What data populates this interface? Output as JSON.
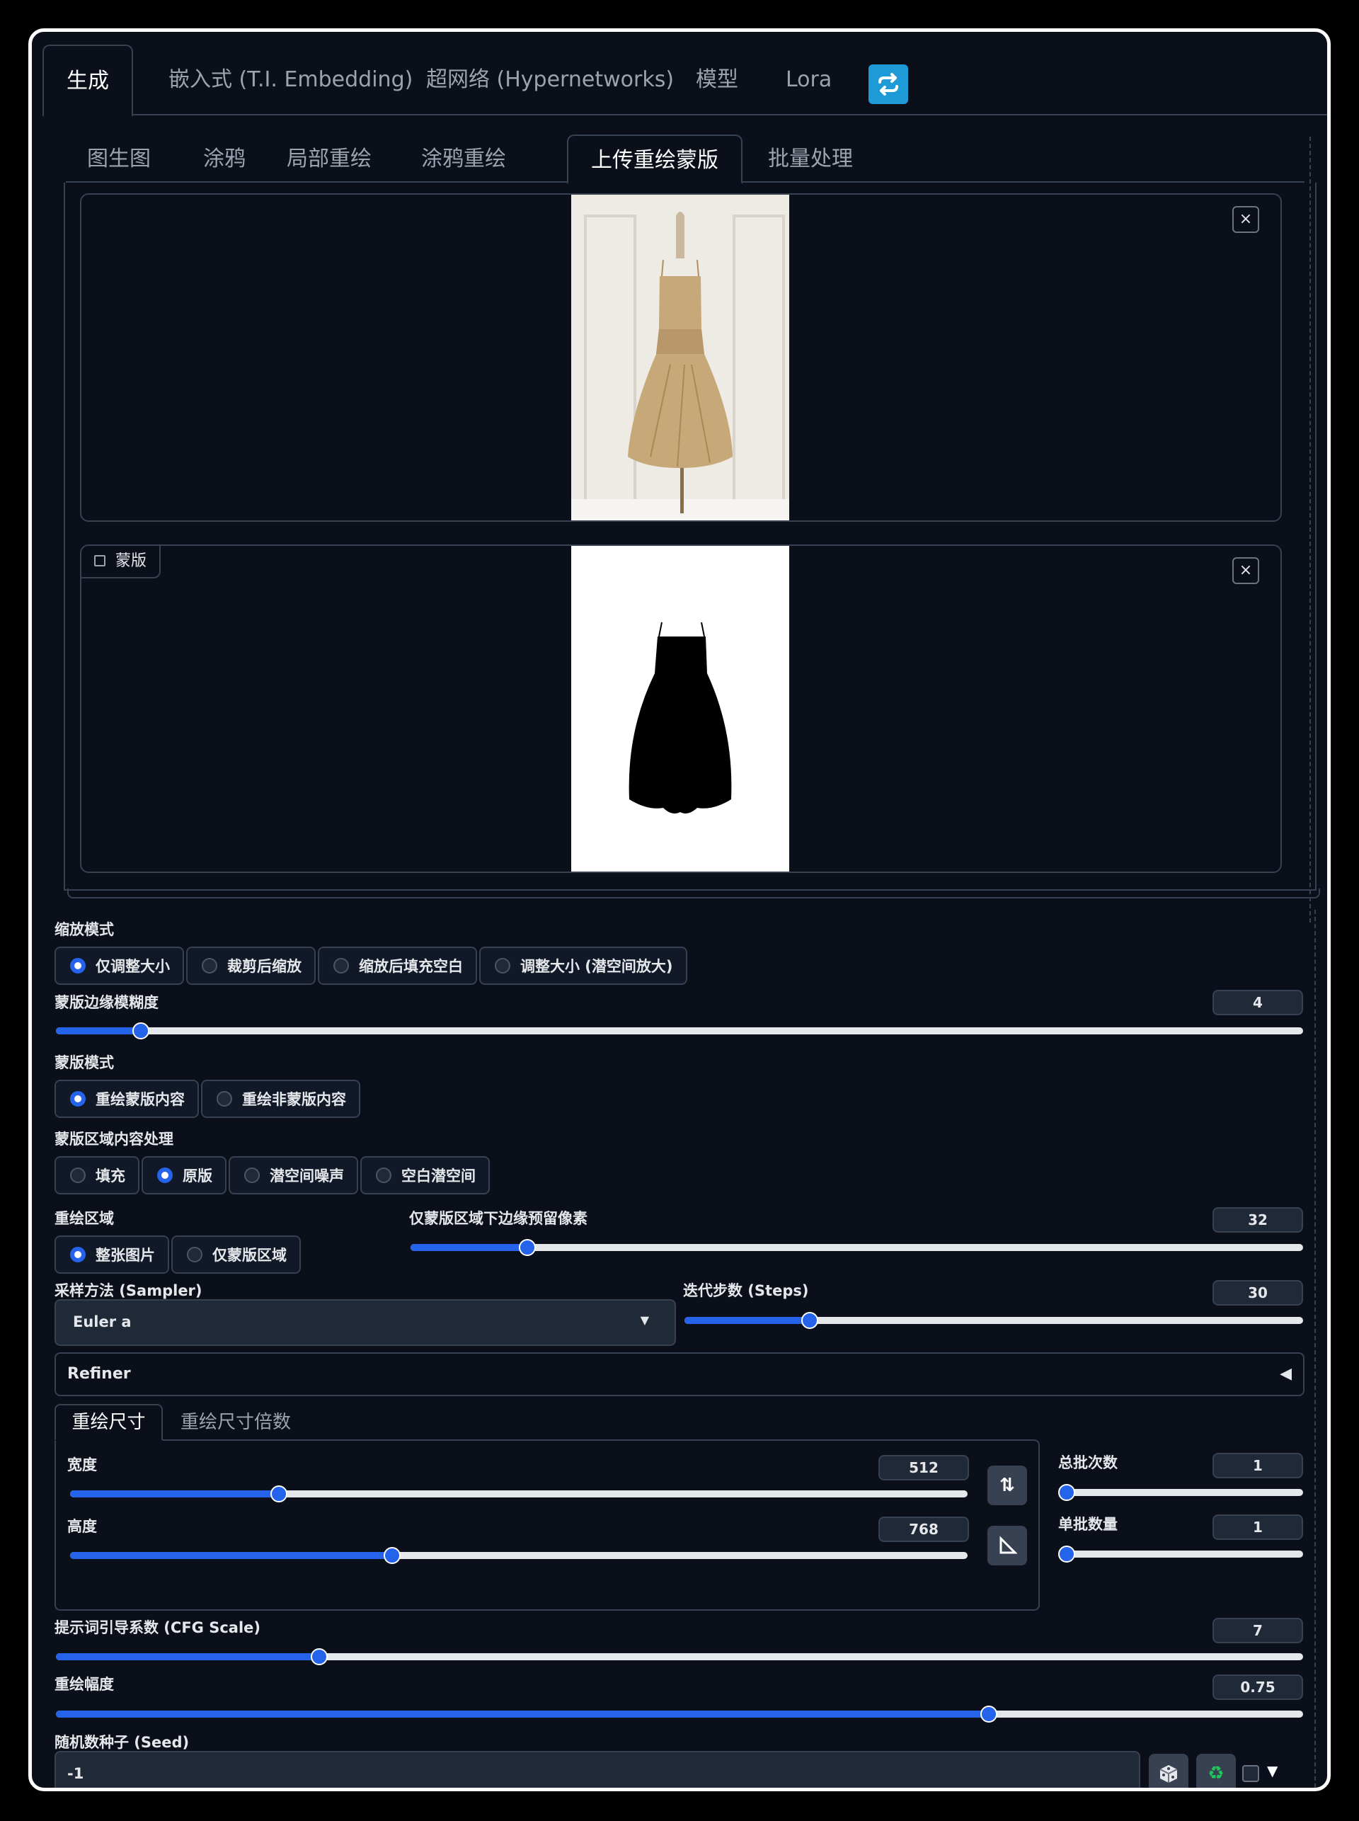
{
  "main_tabs": [
    "生成",
    "嵌入式 (T.I. Embedding)",
    "超网络 (Hypernetworks)",
    "模型",
    "Lora"
  ],
  "sub_tabs": [
    "图生图",
    "涂鸦",
    "局部重绘",
    "涂鸦重绘",
    "上传重绘蒙版",
    "批量处理"
  ],
  "images": {
    "close_label": "×",
    "mask_label": "蒙版"
  },
  "resize_mode": {
    "label": "缩放模式",
    "options": [
      "仅调整大小",
      "裁剪后缩放",
      "缩放后填充空白",
      "调整大小 (潜空间放大)"
    ],
    "selected": 0
  },
  "mask_blur": {
    "label": "蒙版边缘模糊度",
    "value": "4",
    "fraction": 0.068
  },
  "mask_mode": {
    "label": "蒙版模式",
    "options": [
      "重绘蒙版内容",
      "重绘非蒙版内容"
    ],
    "selected": 0
  },
  "masked_content": {
    "label": "蒙版区域内容处理",
    "options": [
      "填充",
      "原版",
      "潜空间噪声",
      "空白潜空间"
    ],
    "selected": 1
  },
  "inpaint_area": {
    "label": "重绘区域",
    "options": [
      "整张图片",
      "仅蒙版区域"
    ],
    "selected": 0
  },
  "only_masked_padding": {
    "label": "仅蒙版区域下边缘预留像素",
    "value": "32",
    "fraction": 0.131
  },
  "sampler": {
    "label": "采样方法 (Sampler)",
    "value": "Euler a"
  },
  "steps": {
    "label": "迭代步数 (Steps)",
    "value": "30",
    "fraction": 0.203
  },
  "refiner": {
    "label": "Refiner"
  },
  "size_tabs": [
    "重绘尺寸",
    "重绘尺寸倍数"
  ],
  "width": {
    "label": "宽度",
    "value": "512",
    "fraction": 0.233
  },
  "height": {
    "label": "高度",
    "value": "768",
    "fraction": 0.359
  },
  "batch_count": {
    "label": "总批次数",
    "value": "1",
    "fraction": 0.0
  },
  "batch_size": {
    "label": "单批数量",
    "value": "1",
    "fraction": 0.0
  },
  "cfg_scale": {
    "label": "提示词引导系数 (CFG Scale)",
    "value": "7",
    "fraction": 0.211
  },
  "denoising": {
    "label": "重绘幅度",
    "value": "0.75",
    "fraction": 0.748
  },
  "seed": {
    "label": "随机数种子 (Seed)",
    "value": "-1"
  },
  "colors": {
    "accent": "#2563eb",
    "refresh": "#1e9bd7",
    "recycle": "#22c55e"
  }
}
